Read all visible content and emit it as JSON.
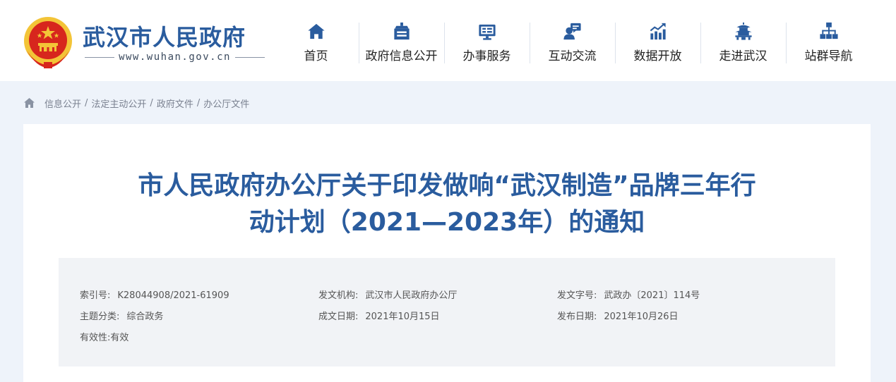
{
  "header": {
    "site_name": "武汉市人民政府",
    "site_url": "www.wuhan.gov.cn"
  },
  "nav": [
    {
      "label": "首页",
      "icon": "home-icon"
    },
    {
      "label": "政府信息公开",
      "icon": "notice-board-icon"
    },
    {
      "label": "办事服务",
      "icon": "monitor-icon"
    },
    {
      "label": "互动交流",
      "icon": "chat-user-icon"
    },
    {
      "label": "数据开放",
      "icon": "bar-chart-icon"
    },
    {
      "label": "走进武汉",
      "icon": "pavilion-icon"
    },
    {
      "label": "站群导航",
      "icon": "sitemap-icon"
    }
  ],
  "breadcrumb": [
    "信息公开",
    "法定主动公开",
    "政府文件",
    "办公厅文件"
  ],
  "breadcrumb_sep": "/",
  "article": {
    "title_line1": "市人民政府办公厅关于印发做响“武汉制造”品牌三年行",
    "title_line2": "动计划（2021—2023年）的通知"
  },
  "meta": {
    "index_no_key": "索引号:",
    "index_no": "K28044908/2021-61909",
    "issuer_key": "发文机构:",
    "issuer": "武汉市人民政府办公厅",
    "doc_no_key": "发文字号:",
    "doc_no": "武政办〔2021〕114号",
    "topic_key": "主题分类:",
    "topic": "综合政务",
    "written_date_key": "成文日期:",
    "written_date": "2021年10月15日",
    "publish_date_key": "发布日期:",
    "publish_date": "2021年10月26日",
    "validity_key": "有效性:",
    "validity": "有效"
  },
  "colors": {
    "brand_blue": "#2a5c9e",
    "emblem_red": "#d7261d",
    "emblem_gold": "#f3c437",
    "page_bg": "#eef3fa"
  }
}
